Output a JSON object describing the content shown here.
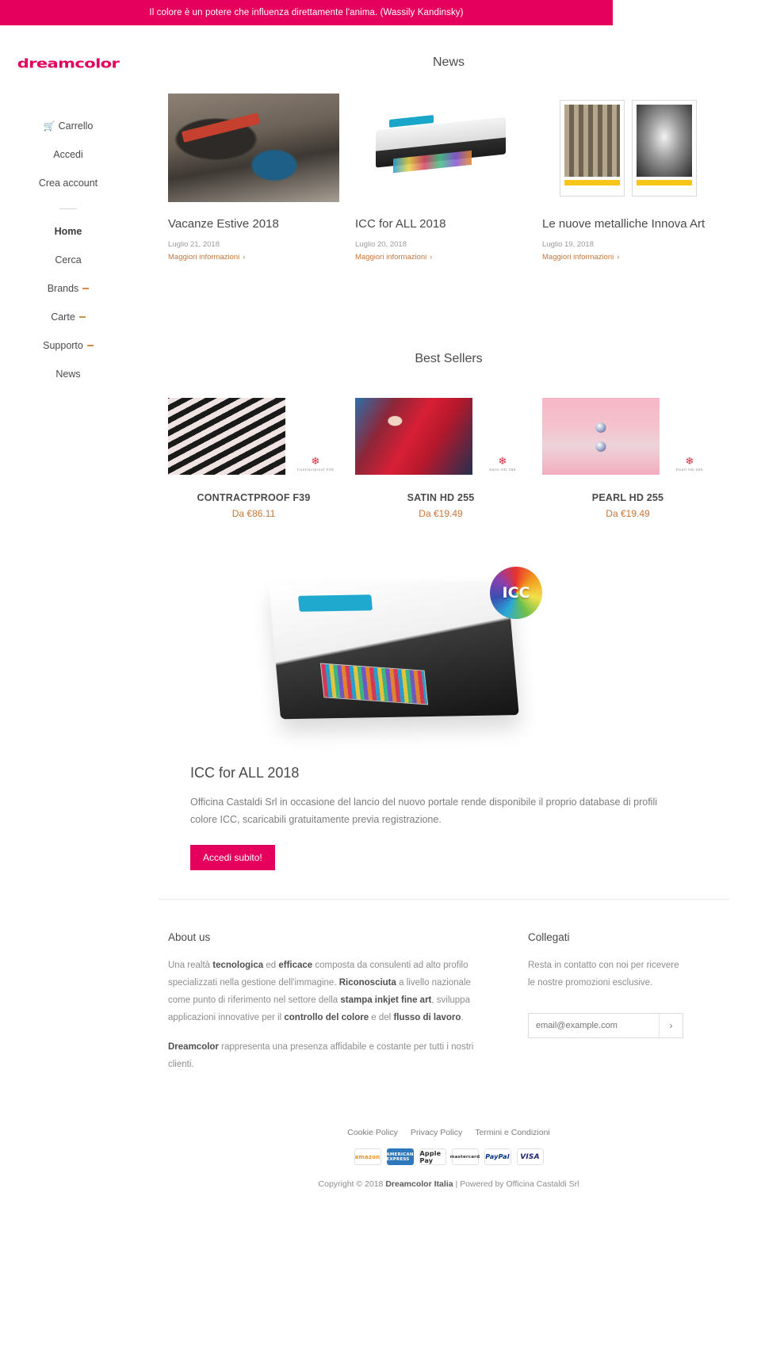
{
  "promo": {
    "text": "Il colore è un potere che influenza direttamente l'anima. (Wassily Kandinsky)",
    "background": "#e4005c"
  },
  "brand": {
    "logo_text": "dreamcolor",
    "color": "#e4005c"
  },
  "sidebar": {
    "account_items": [
      {
        "label": "Carrello",
        "icon": "cart-icon"
      },
      {
        "label": "Accedi",
        "icon": ""
      },
      {
        "label": "Crea account",
        "icon": ""
      }
    ],
    "main_items": [
      {
        "label": "Home",
        "has_dropdown": false
      },
      {
        "label": "Cerca",
        "has_dropdown": false
      },
      {
        "label": "Brands",
        "has_dropdown": true
      },
      {
        "label": "Carte",
        "has_dropdown": true
      },
      {
        "label": "Supporto",
        "has_dropdown": true
      },
      {
        "label": "News",
        "has_dropdown": false
      }
    ]
  },
  "news": {
    "title": "News",
    "link_label": "Maggiori informazioni",
    "items": [
      {
        "title": "Vacanze Estive 2018",
        "date": "Luglio 21, 2018",
        "image": "suitcase-photo"
      },
      {
        "title": "ICC for ALL 2018",
        "date": "Luglio 20, 2018",
        "image": "printer-photo"
      },
      {
        "title": "Le nuove metalliche Innova Art",
        "date": "Luglio 19, 2018",
        "image": "posters-photo"
      }
    ]
  },
  "best_sellers": {
    "title": "Best Sellers",
    "items": [
      {
        "name": "CONTRACTPROOF F39",
        "price": "Da €86.11",
        "swatch_caption": "Contractproof F39"
      },
      {
        "name": "SATIN HD 255",
        "price": "Da €19.49",
        "swatch_caption": "Satin HD 255"
      },
      {
        "name": "PEARL HD 255",
        "price": "Da €19.49",
        "swatch_caption": "Pearl HD 255"
      }
    ]
  },
  "icc": {
    "badge_text": "ICC",
    "heading": "ICC for ALL 2018",
    "paragraph": "Officina Castaldi Srl in occasione del lancio del nuovo portale rende disponibile il proprio database di profili colore ICC, scaricabili gratuitamente previa registrazione.",
    "button_label": "Accedi subito!"
  },
  "footer": {
    "about": {
      "heading": "About us",
      "p1_a": "Una realtà ",
      "p1_b1": "tecnologica",
      "p1_c": " ed ",
      "p1_b2": "efficace",
      "p1_d": " composta da consulenti ad alto profilo specializzati nella gestione dell'immagine. ",
      "p1_b3": "Riconosciuta",
      "p1_e": " a livello nazionale come punto di riferimento nel settore della ",
      "p1_b4": "stampa inkjet fine art",
      "p1_f": ", sviluppa applicazioni innovative per il ",
      "p1_b5": "controllo del colore",
      "p1_g": " e del ",
      "p1_b6": "flusso di lavoro",
      "p1_h": ".",
      "p2_b": "Dreamcolor",
      "p2_t": " rappresenta una presenza affidabile e costante per tutti i nostri clienti."
    },
    "connect": {
      "heading": "Collegati",
      "text": "Resta in contatto con noi per ricevere le nostre promozioni esclusive.",
      "email_placeholder": "email@example.com",
      "email_value": "",
      "submit_glyph": "›"
    },
    "legal_links": [
      "Cookie Policy",
      "Privacy Policy",
      "Termini e Condizioni"
    ],
    "payments": [
      "amazon",
      "AMERICAN EXPRESS",
      "Apple Pay",
      "mastercard",
      "PayPal",
      "VISA"
    ],
    "copyright_a": "Copyright © 2018 ",
    "copyright_b": "Dreamcolor Italia",
    "copyright_c": " | Powered by Officina Castaldi Srl"
  }
}
